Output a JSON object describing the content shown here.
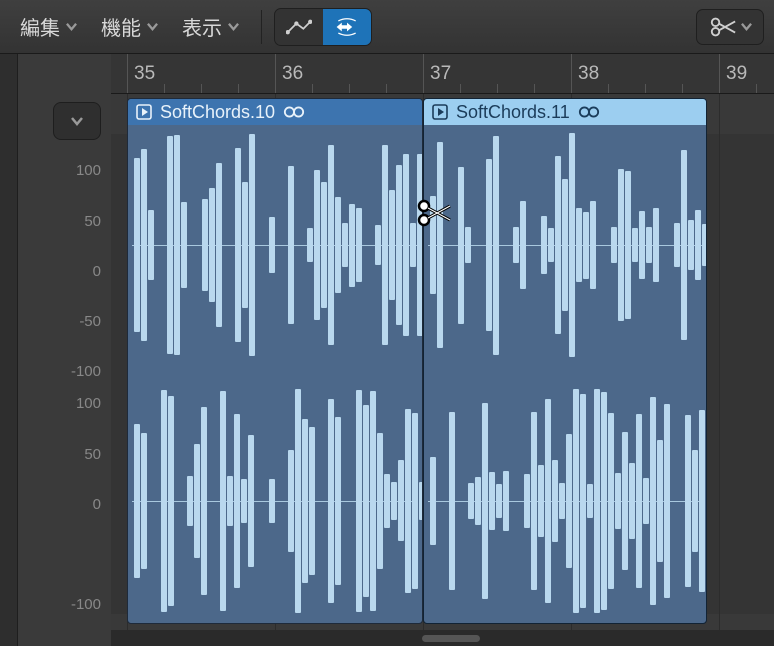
{
  "menus": {
    "edit": "編集",
    "functions": "機能",
    "view": "表示"
  },
  "ruler": {
    "ticks": [
      {
        "label": "35",
        "pos": 16
      },
      {
        "label": "36",
        "pos": 164
      },
      {
        "label": "37",
        "pos": 312
      },
      {
        "label": "38",
        "pos": 460
      },
      {
        "label": "39",
        "pos": 608
      }
    ]
  },
  "amplitude_labels": {
    "top": [
      "100",
      "50",
      "0",
      "-50",
      "-100"
    ],
    "bot": [
      "100",
      "50",
      "0",
      "-100"
    ]
  },
  "regions": [
    {
      "name": "SoftChords.10",
      "startPx": 16,
      "widthPx": 296,
      "selected": false
    },
    {
      "name": "SoftChords.11",
      "startPx": 312,
      "widthPx": 284,
      "selected": true
    }
  ],
  "cursor_tool": "scissors"
}
